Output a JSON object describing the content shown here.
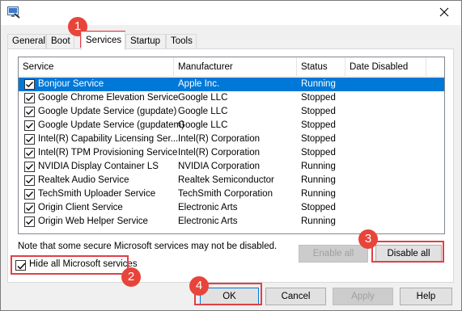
{
  "tabs": [
    "General",
    "Boot",
    "Services",
    "Startup",
    "Tools"
  ],
  "active_tab": "Services",
  "columns": [
    "Service",
    "Manufacturer",
    "Status",
    "Date Disabled"
  ],
  "services": [
    {
      "name": "Bonjour Service",
      "manufacturer": "Apple Inc.",
      "status": "Running",
      "date_disabled": "",
      "checked": true,
      "selected": true
    },
    {
      "name": "Google Chrome Elevation Service",
      "manufacturer": "Google LLC",
      "status": "Stopped",
      "date_disabled": "",
      "checked": true
    },
    {
      "name": "Google Update Service (gupdate)",
      "manufacturer": "Google LLC",
      "status": "Stopped",
      "date_disabled": "",
      "checked": true
    },
    {
      "name": "Google Update Service (gupdatem)",
      "manufacturer": "Google LLC",
      "status": "Stopped",
      "date_disabled": "",
      "checked": true
    },
    {
      "name": "Intel(R) Capability Licensing Ser...",
      "manufacturer": "Intel(R) Corporation",
      "status": "Stopped",
      "date_disabled": "",
      "checked": true
    },
    {
      "name": "Intel(R) TPM Provisioning Service",
      "manufacturer": "Intel(R) Corporation",
      "status": "Stopped",
      "date_disabled": "",
      "checked": true
    },
    {
      "name": "NVIDIA Display Container LS",
      "manufacturer": "NVIDIA Corporation",
      "status": "Running",
      "date_disabled": "",
      "checked": true
    },
    {
      "name": "Realtek Audio Service",
      "manufacturer": "Realtek Semiconductor",
      "status": "Running",
      "date_disabled": "",
      "checked": true
    },
    {
      "name": "TechSmith Uploader Service",
      "manufacturer": "TechSmith Corporation",
      "status": "Running",
      "date_disabled": "",
      "checked": true
    },
    {
      "name": "Origin Client Service",
      "manufacturer": "Electronic Arts",
      "status": "Stopped",
      "date_disabled": "",
      "checked": true
    },
    {
      "name": "Origin Web Helper Service",
      "manufacturer": "Electronic Arts",
      "status": "Running",
      "date_disabled": "",
      "checked": true
    }
  ],
  "note": "Note that some secure Microsoft services may not be disabled.",
  "hide_ms": {
    "label": "Hide all Microsoft services",
    "checked": true
  },
  "buttons": {
    "enable_all": "Enable all",
    "disable_all": "Disable all",
    "ok": "OK",
    "cancel": "Cancel",
    "apply": "Apply",
    "help": "Help"
  },
  "steps": [
    "1",
    "2",
    "3",
    "4"
  ],
  "colors": {
    "highlight": "#e04048",
    "badge": "#e8443a",
    "selection": "#0078d7"
  }
}
